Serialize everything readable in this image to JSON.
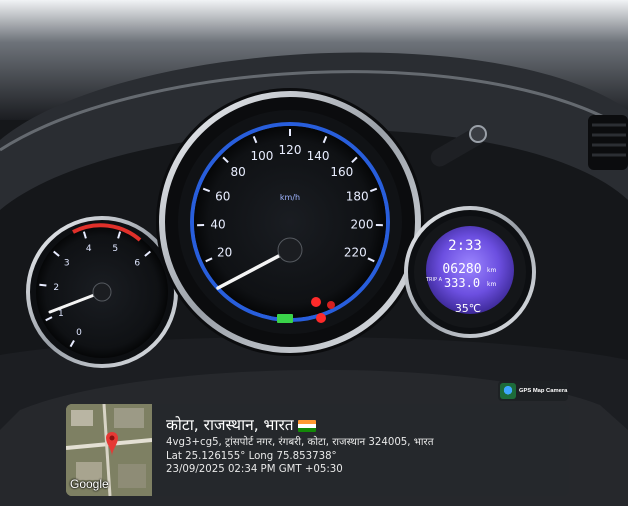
{
  "speedometer": {
    "unit": "km/h",
    "ticks": [
      "20",
      "40",
      "60",
      "80",
      "100",
      "120",
      "140",
      "160",
      "180",
      "200",
      "220"
    ]
  },
  "tachometer": {
    "ticks": [
      "0",
      "1",
      "2",
      "3",
      "4",
      "5",
      "6"
    ]
  },
  "info_display": {
    "clock": "2:33",
    "odometer": "06280",
    "odometer_unit": "km",
    "trip_label": "TRIP A",
    "trip": "333.0",
    "trip_unit": "km",
    "temperature": "35℃"
  },
  "gps_app": {
    "name": "GPS Map Camera"
  },
  "gps_stamp": {
    "city": "कोटा, राजस्थान, भारत",
    "address": "4vg3+cg5, ट्रांसपोर्ट नगर, रंगबरी, कोटा, राजस्थान 324005, भारत",
    "coords": "Lat 25.126155° Long 75.853738°",
    "datetime": "23/09/2025 02:34 PM GMT +05:30",
    "map_brand": "Google"
  },
  "colors": {
    "gauge_blue": "#2d6cff",
    "display_purple": "#7b59e6",
    "chrome": "#d9dde2",
    "warning_red": "#ff2a2a"
  }
}
